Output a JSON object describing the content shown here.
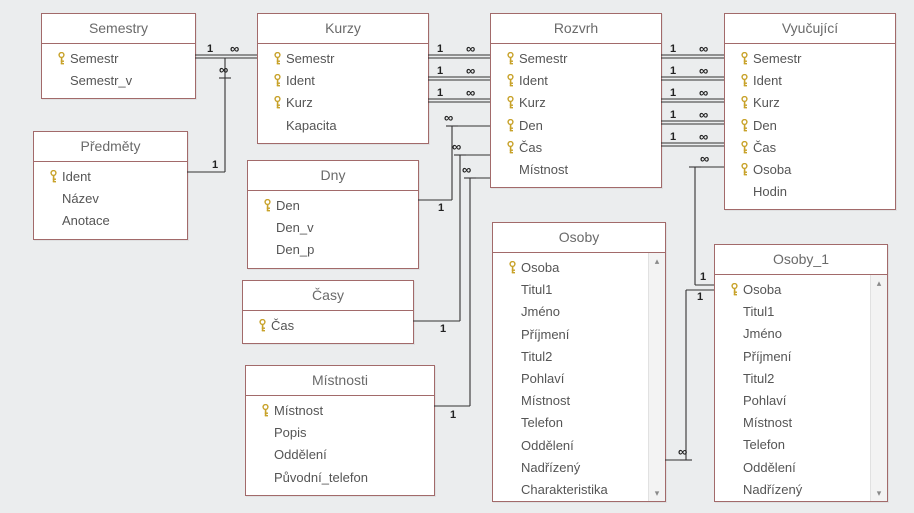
{
  "tables": {
    "semestry": {
      "title": "Semestry",
      "fields": [
        {
          "name": "Semestr",
          "pk": true
        },
        {
          "name": "Semestr_v",
          "pk": false
        }
      ]
    },
    "predmety": {
      "title": "Předměty",
      "fields": [
        {
          "name": "Ident",
          "pk": true
        },
        {
          "name": "Název",
          "pk": false
        },
        {
          "name": "Anotace",
          "pk": false
        }
      ]
    },
    "kurzy": {
      "title": "Kurzy",
      "fields": [
        {
          "name": "Semestr",
          "pk": true
        },
        {
          "name": "Ident",
          "pk": true
        },
        {
          "name": "Kurz",
          "pk": true
        },
        {
          "name": "Kapacita",
          "pk": false
        }
      ]
    },
    "dny": {
      "title": "Dny",
      "fields": [
        {
          "name": "Den",
          "pk": true
        },
        {
          "name": "Den_v",
          "pk": false
        },
        {
          "name": "Den_p",
          "pk": false
        }
      ]
    },
    "casy": {
      "title": "Časy",
      "fields": [
        {
          "name": "Čas",
          "pk": true
        }
      ]
    },
    "mistnosti": {
      "title": "Místnosti",
      "fields": [
        {
          "name": "Místnost",
          "pk": true
        },
        {
          "name": "Popis",
          "pk": false
        },
        {
          "name": "Oddělení",
          "pk": false
        },
        {
          "name": "Původní_telefon",
          "pk": false
        }
      ]
    },
    "rozvrh": {
      "title": "Rozvrh",
      "fields": [
        {
          "name": "Semestr",
          "pk": true
        },
        {
          "name": "Ident",
          "pk": true
        },
        {
          "name": "Kurz",
          "pk": true
        },
        {
          "name": "Den",
          "pk": true
        },
        {
          "name": "Čas",
          "pk": true
        },
        {
          "name": "Místnost",
          "pk": false
        }
      ]
    },
    "vyucujici": {
      "title": "Vyučující",
      "fields": [
        {
          "name": "Semestr",
          "pk": true
        },
        {
          "name": "Ident",
          "pk": true
        },
        {
          "name": "Kurz",
          "pk": true
        },
        {
          "name": "Den",
          "pk": true
        },
        {
          "name": "Čas",
          "pk": true
        },
        {
          "name": "Osoba",
          "pk": true
        },
        {
          "name": "Hodin",
          "pk": false
        }
      ]
    },
    "osoby": {
      "title": "Osoby",
      "scroll": true,
      "fields": [
        {
          "name": "Osoba",
          "pk": true
        },
        {
          "name": "Titul1",
          "pk": false
        },
        {
          "name": "Jméno",
          "pk": false
        },
        {
          "name": "Příjmení",
          "pk": false
        },
        {
          "name": "Titul2",
          "pk": false
        },
        {
          "name": "Pohlaví",
          "pk": false
        },
        {
          "name": "Místnost",
          "pk": false
        },
        {
          "name": "Telefon",
          "pk": false
        },
        {
          "name": "Oddělení",
          "pk": false
        },
        {
          "name": "Nadřízený",
          "pk": false
        },
        {
          "name": "Charakteristika",
          "pk": false
        }
      ]
    },
    "osoby1": {
      "title": "Osoby_1",
      "scroll": true,
      "fields": [
        {
          "name": "Osoba",
          "pk": true
        },
        {
          "name": "Titul1",
          "pk": false
        },
        {
          "name": "Jméno",
          "pk": false
        },
        {
          "name": "Příjmení",
          "pk": false
        },
        {
          "name": "Titul2",
          "pk": false
        },
        {
          "name": "Pohlaví",
          "pk": false
        },
        {
          "name": "Místnost",
          "pk": false
        },
        {
          "name": "Telefon",
          "pk": false
        },
        {
          "name": "Oddělení",
          "pk": false
        },
        {
          "name": "Nadřízený",
          "pk": false
        }
      ]
    }
  },
  "relations": [
    {
      "from": "semestry.Semestr",
      "to": "kurzy.Semestr",
      "card": [
        "1",
        "∞"
      ]
    },
    {
      "from": "semestry.Semestr",
      "to": "kurzy.Ident",
      "bridge_for": "predmety"
    },
    {
      "from": "predmety.Ident",
      "to": "kurzy.Ident",
      "card": [
        "1",
        "∞"
      ]
    },
    {
      "from": "kurzy.Semestr",
      "to": "rozvrh.Semestr",
      "card": [
        "1",
        "∞"
      ]
    },
    {
      "from": "kurzy.Ident",
      "to": "rozvrh.Ident",
      "card": [
        "1",
        "∞"
      ]
    },
    {
      "from": "kurzy.Kurz",
      "to": "rozvrh.Kurz",
      "card": [
        "1",
        "∞"
      ]
    },
    {
      "from": "dny.Den",
      "to": "rozvrh.Den",
      "card": [
        "1",
        "∞"
      ]
    },
    {
      "from": "casy.Čas",
      "to": "rozvrh.Čas",
      "card": [
        "1",
        "∞"
      ]
    },
    {
      "from": "mistnosti.Místnost",
      "to": "rozvrh.Místnost",
      "card": [
        "1",
        "∞"
      ]
    },
    {
      "from": "rozvrh.Semestr",
      "to": "vyucujici.Semestr",
      "card": [
        "1",
        "∞"
      ]
    },
    {
      "from": "rozvrh.Ident",
      "to": "vyucujici.Ident",
      "card": [
        "1",
        "∞"
      ]
    },
    {
      "from": "rozvrh.Kurz",
      "to": "vyucujici.Kurz",
      "card": [
        "1",
        "∞"
      ]
    },
    {
      "from": "rozvrh.Den",
      "to": "vyucujici.Den",
      "card": [
        "1",
        "∞"
      ]
    },
    {
      "from": "rozvrh.Čas",
      "to": "vyucujici.Čas",
      "card": [
        "1",
        "∞"
      ]
    },
    {
      "from": "osoby1.Osoba",
      "to": "vyucujici.Osoba",
      "card": [
        "1",
        "∞"
      ]
    },
    {
      "from": "osoby1.Osoba",
      "to": "osoby.Nadřízený",
      "card": [
        "1",
        "∞"
      ]
    }
  ]
}
